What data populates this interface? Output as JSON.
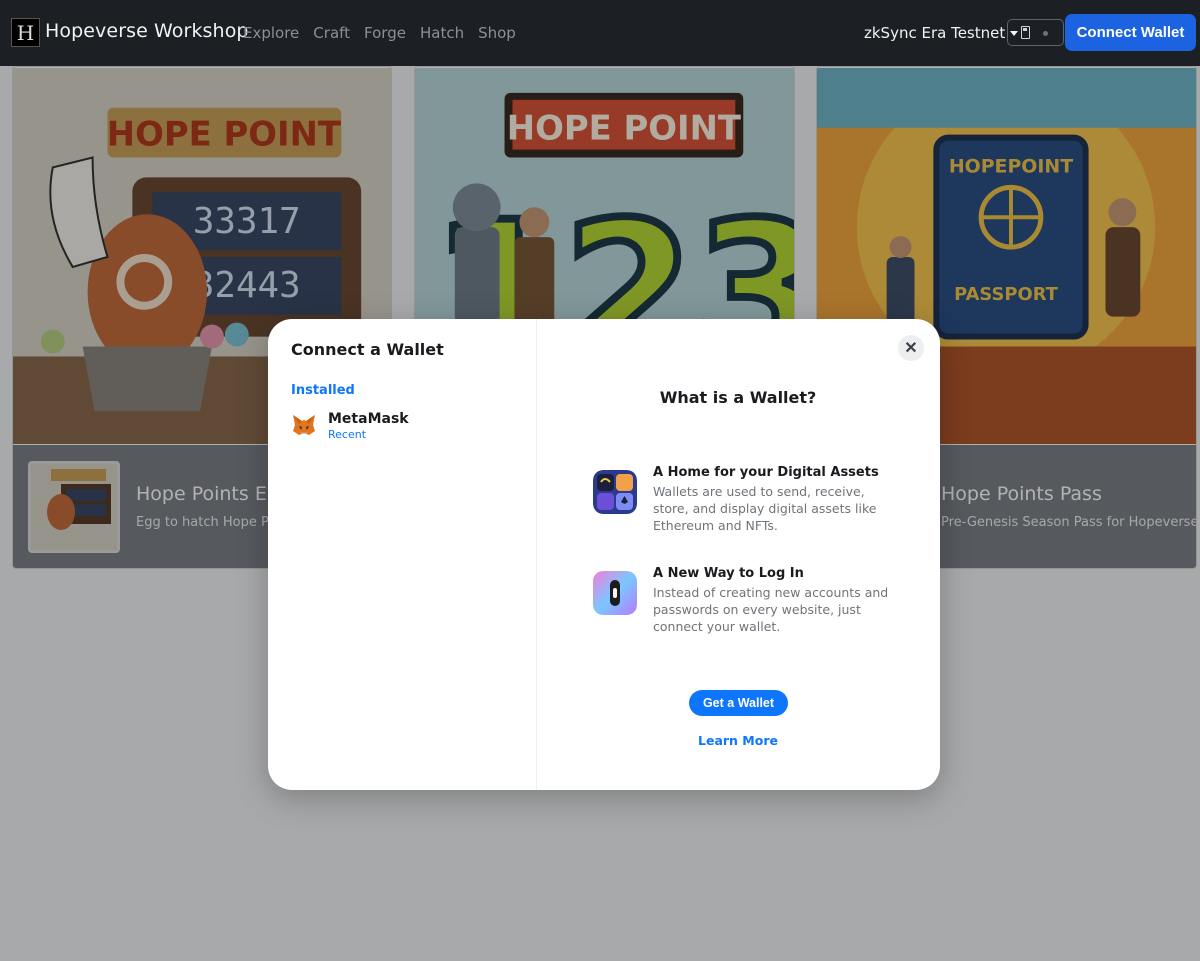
{
  "navbar": {
    "brand": "Hopeverse Workshop",
    "links": [
      "Explore",
      "Craft",
      "Forge",
      "Hatch",
      "Shop"
    ],
    "network": "zkSync Era Testnet",
    "connect_label": "Connect Wallet"
  },
  "cards": [
    {
      "title": "Hope Points Egg",
      "desc": "Egg to hatch Hope Points",
      "art_title": "HOPE POINT",
      "art_digits": "3 3 3 1 7 / 3 2 4 4 3"
    },
    {
      "title": "",
      "desc": "",
      "art_title": "HOPE POINT",
      "art_digits": "123"
    },
    {
      "title": "Hope Points Pass",
      "desc": "Pre-Genesis Season Pass for Hopeverse",
      "art_title": "HOPEPOINT",
      "art_sub": "PASSPORT"
    }
  ],
  "modal": {
    "title": "Connect a Wallet",
    "section": "Installed",
    "wallets": [
      {
        "name": "MetaMask",
        "sub": "Recent"
      }
    ],
    "close_icon": "✕",
    "what_title": "What is a Wallet?",
    "info": [
      {
        "head": "A Home for your Digital Assets",
        "body": "Wallets are used to send, receive, store, and display digital assets like Ethereum and NFTs."
      },
      {
        "head": "A New Way to Log In",
        "body": "Instead of creating new accounts and passwords on every website, just connect your wallet."
      }
    ],
    "get_wallet": "Get a Wallet",
    "learn_more": "Learn More"
  },
  "colors": {
    "accent": "#0e76fd",
    "navbar": "#1c2024",
    "connect_button": "#1b63e0"
  }
}
